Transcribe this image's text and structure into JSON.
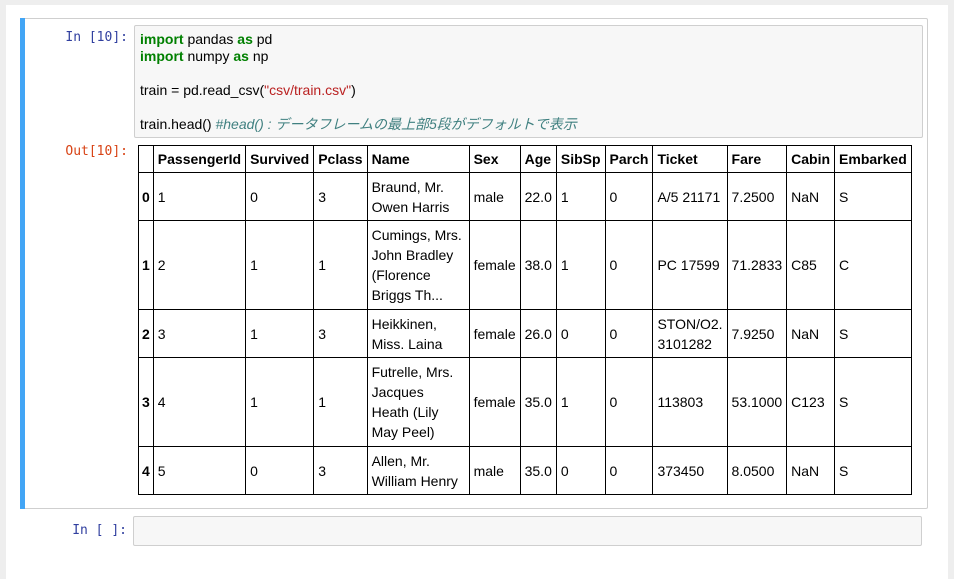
{
  "cell1": {
    "in_prompt": "In [10]:",
    "out_prompt": "Out[10]:",
    "code": {
      "line1": {
        "kw1": "import",
        "mid": " pandas ",
        "kw2": "as",
        "end": " pd"
      },
      "line2": {
        "kw1": "import",
        "mid": " numpy ",
        "kw2": "as",
        "end": " np"
      },
      "line3": {
        "pre": "train = pd.read_csv(",
        "str": "\"csv/train.csv\"",
        "post": ")"
      },
      "line4": {
        "pre": "train.head() ",
        "comment": "#head() : データフレームの最上部5段がデフォルトで表示"
      }
    }
  },
  "dataframe": {
    "columns": [
      "PassengerId",
      "Survived",
      "Pclass",
      "Name",
      "Sex",
      "Age",
      "SibSp",
      "Parch",
      "Ticket",
      "Fare",
      "Cabin",
      "Embarked"
    ],
    "rows": [
      {
        "index": "0",
        "PassengerId": "1",
        "Survived": "0",
        "Pclass": "3",
        "Name": "Braund, Mr. Owen Harris",
        "Sex": "male",
        "Age": "22.0",
        "SibSp": "1",
        "Parch": "0",
        "Ticket": "A/5 21171",
        "Fare": "7.2500",
        "Cabin": "NaN",
        "Embarked": "S"
      },
      {
        "index": "1",
        "PassengerId": "2",
        "Survived": "1",
        "Pclass": "1",
        "Name": "Cumings, Mrs. John Bradley (Florence Briggs Th...",
        "Sex": "female",
        "Age": "38.0",
        "SibSp": "1",
        "Parch": "0",
        "Ticket": "PC 17599",
        "Fare": "71.2833",
        "Cabin": "C85",
        "Embarked": "C"
      },
      {
        "index": "2",
        "PassengerId": "3",
        "Survived": "1",
        "Pclass": "3",
        "Name": "Heikkinen, Miss. Laina",
        "Sex": "female",
        "Age": "26.0",
        "SibSp": "0",
        "Parch": "0",
        "Ticket": "STON/O2. 3101282",
        "Fare": "7.9250",
        "Cabin": "NaN",
        "Embarked": "S"
      },
      {
        "index": "3",
        "PassengerId": "4",
        "Survived": "1",
        "Pclass": "1",
        "Name": "Futrelle, Mrs. Jacques Heath (Lily May Peel)",
        "Sex": "female",
        "Age": "35.0",
        "SibSp": "1",
        "Parch": "0",
        "Ticket": "113803",
        "Fare": "53.1000",
        "Cabin": "C123",
        "Embarked": "S"
      },
      {
        "index": "4",
        "PassengerId": "5",
        "Survived": "0",
        "Pclass": "3",
        "Name": "Allen, Mr. William Henry",
        "Sex": "male",
        "Age": "35.0",
        "SibSp": "0",
        "Parch": "0",
        "Ticket": "373450",
        "Fare": "8.0500",
        "Cabin": "NaN",
        "Embarked": "S"
      }
    ]
  },
  "cell2": {
    "in_prompt": "In [ ]:"
  },
  "colors": {
    "selected_bar": "#42a5f5",
    "in_prompt": "#303f9f",
    "out_prompt": "#d84315",
    "keyword": "#008000",
    "string": "#ba2121",
    "comment": "#408080"
  }
}
